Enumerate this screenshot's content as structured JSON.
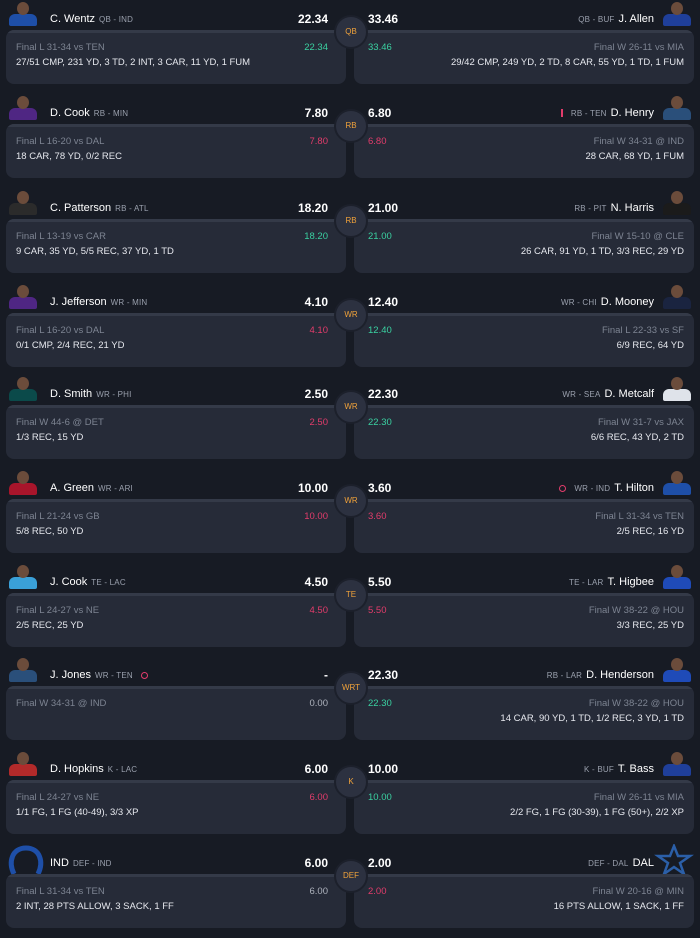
{
  "colors": {
    "background": "#171b24",
    "card": "#262b38",
    "badge_text": "#f0a23a",
    "green": "#3ad1a1",
    "red": "#e23c6b"
  },
  "matchups": [
    {
      "position": "QB",
      "left": {
        "name": "C. Wentz",
        "pos": "QB",
        "team": "IND",
        "points": "22.34",
        "projection": "22.34",
        "proj_color": "green",
        "game": "Final L 31-34 vs TEN",
        "stats": "27/51 CMP, 231 YD, 3 TD, 2 INT, 3 CAR, 11 YD, 1 FUM",
        "jersey": "#1e4fa8"
      },
      "right": {
        "name": "J. Allen",
        "pos": "QB",
        "team": "BUF",
        "points": "33.46",
        "projection": "33.46",
        "proj_color": "green",
        "game": "Final W 26-11 vs MIA",
        "stats": "29/42 CMP, 249 YD, 2 TD, 8 CAR, 55 YD, 1 TD, 1 FUM",
        "jersey": "#1f3f9a"
      }
    },
    {
      "position": "RB",
      "left": {
        "name": "D. Cook",
        "pos": "RB",
        "team": "MIN",
        "points": "7.80",
        "projection": "7.80",
        "proj_color": "red",
        "game": "Final L 16-20 vs DAL",
        "stats": "18 CAR, 78 YD, 0/2 REC",
        "jersey": "#4f2683"
      },
      "right": {
        "name": "D. Henry",
        "pos": "RB",
        "team": "TEN",
        "points": "6.80",
        "projection": "6.80",
        "proj_color": "red",
        "game": "Final W 34-31 @ IND",
        "stats": "28 CAR, 68 YD, 1 FUM",
        "jersey": "#2a4f7a",
        "status": "bar"
      }
    },
    {
      "position": "RB",
      "left": {
        "name": "C. Patterson",
        "pos": "RB",
        "team": "ATL",
        "points": "18.20",
        "projection": "18.20",
        "proj_color": "green",
        "game": "Final L 13-19 vs CAR",
        "stats": "9 CAR, 35 YD, 5/5 REC, 37 YD, 1 TD",
        "jersey": "#2b2b2b"
      },
      "right": {
        "name": "N. Harris",
        "pos": "RB",
        "team": "PIT",
        "points": "21.00",
        "projection": "21.00",
        "proj_color": "green",
        "game": "Final W 15-10 @ CLE",
        "stats": "26 CAR, 91 YD, 1 TD, 3/3 REC, 29 YD",
        "jersey": "#1b1b1b"
      }
    },
    {
      "position": "WR",
      "left": {
        "name": "J. Jefferson",
        "pos": "WR",
        "team": "MIN",
        "points": "4.10",
        "projection": "4.10",
        "proj_color": "red",
        "game": "Final L 16-20 vs DAL",
        "stats": "0/1 CMP, 2/4 REC, 21 YD",
        "jersey": "#4f2683"
      },
      "right": {
        "name": "D. Mooney",
        "pos": "WR",
        "team": "CHI",
        "points": "12.40",
        "projection": "12.40",
        "proj_color": "green",
        "game": "Final L 22-33 vs SF",
        "stats": "6/9 REC, 64 YD",
        "jersey": "#1a2440"
      }
    },
    {
      "position": "WR",
      "left": {
        "name": "D. Smith",
        "pos": "WR",
        "team": "PHI",
        "points": "2.50",
        "projection": "2.50",
        "proj_color": "red",
        "game": "Final W 44-6 @ DET",
        "stats": "1/3 REC, 15 YD",
        "jersey": "#0b4a4a"
      },
      "right": {
        "name": "D. Metcalf",
        "pos": "WR",
        "team": "SEA",
        "points": "22.30",
        "projection": "22.30",
        "proj_color": "green",
        "game": "Final W 31-7 vs JAX",
        "stats": "6/6 REC, 43 YD, 2 TD",
        "jersey": "#dfe3ea"
      }
    },
    {
      "position": "WR",
      "left": {
        "name": "A. Green",
        "pos": "WR",
        "team": "ARI",
        "points": "10.00",
        "projection": "10.00",
        "proj_color": "red",
        "game": "Final L 21-24 vs GB",
        "stats": "5/8 REC, 50 YD",
        "jersey": "#a8152b"
      },
      "right": {
        "name": "T. Hilton",
        "pos": "WR",
        "team": "IND",
        "points": "3.60",
        "projection": "3.60",
        "proj_color": "red",
        "game": "Final L 31-34 vs TEN",
        "stats": "2/5 REC, 16 YD",
        "jersey": "#1e4fa8",
        "status": "dot"
      }
    },
    {
      "position": "TE",
      "left": {
        "name": "J. Cook",
        "pos": "TE",
        "team": "LAC",
        "points": "4.50",
        "projection": "4.50",
        "proj_color": "red",
        "game": "Final L 24-27 vs NE",
        "stats": "2/5 REC, 25 YD",
        "jersey": "#3aa0d8"
      },
      "right": {
        "name": "T. Higbee",
        "pos": "TE",
        "team": "LAR",
        "points": "5.50",
        "projection": "5.50",
        "proj_color": "red",
        "game": "Final W 38-22 @ HOU",
        "stats": "3/3 REC, 25 YD",
        "jersey": "#1f4bb8"
      }
    },
    {
      "position": "WRT",
      "left": {
        "name": "J. Jones",
        "pos": "WR",
        "team": "TEN",
        "points": "-",
        "projection": "0.00",
        "proj_color": "gray",
        "game": "Final W 34-31 @ IND",
        "stats": "",
        "jersey": "#2a4f7a",
        "status": "dot"
      },
      "right": {
        "name": "D. Henderson",
        "pos": "RB",
        "team": "LAR",
        "points": "22.30",
        "projection": "22.30",
        "proj_color": "green",
        "game": "Final W 38-22 @ HOU",
        "stats": "14 CAR, 90 YD, 1 TD, 1/2 REC, 3 YD, 1 TD",
        "jersey": "#1f4bb8"
      }
    },
    {
      "position": "K",
      "left": {
        "name": "D. Hopkins",
        "pos": "K",
        "team": "LAC",
        "points": "6.00",
        "projection": "6.00",
        "proj_color": "red",
        "game": "Final L 24-27 vs NE",
        "stats": "1/1 FG, 1 FG (40-49), 3/3 XP",
        "jersey": "#b22a2a"
      },
      "right": {
        "name": "T. Bass",
        "pos": "K",
        "team": "BUF",
        "points": "10.00",
        "projection": "10.00",
        "proj_color": "green",
        "game": "Final W 26-11 vs MIA",
        "stats": "2/2 FG, 1 FG (30-39), 1 FG (50+), 2/2 XP",
        "jersey": "#1f3f9a"
      }
    },
    {
      "position": "DEF",
      "left": {
        "name": "IND",
        "pos": "DEF",
        "team": "IND",
        "points": "6.00",
        "projection": "6.00",
        "proj_color": "gray",
        "game": "Final L 31-34 vs TEN",
        "stats": "2 INT, 28 PTS ALLOW, 3 SACK, 1 FF",
        "logo": "horseshoe"
      },
      "right": {
        "name": "DAL",
        "pos": "DEF",
        "team": "DAL",
        "points": "2.00",
        "projection": "2.00",
        "proj_color": "red",
        "game": "Final W 20-16 @ MIN",
        "stats": "16 PTS ALLOW, 1 SACK, 1 FF",
        "logo": "star"
      }
    }
  ]
}
